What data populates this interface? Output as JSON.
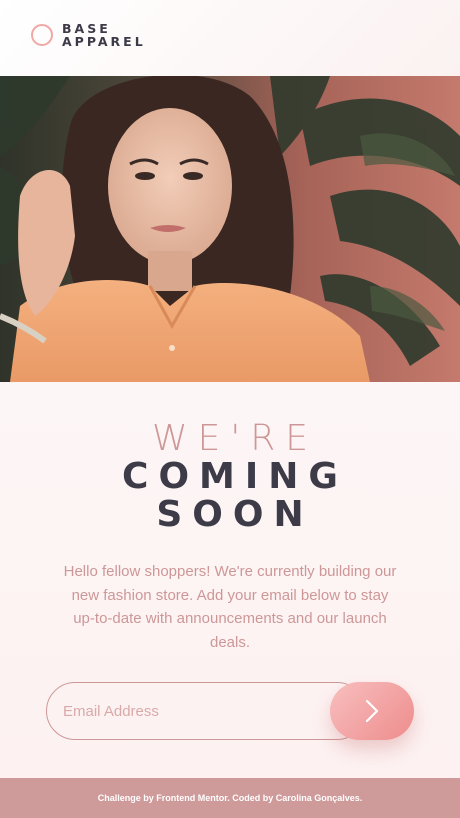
{
  "brand": {
    "line1": "BASE",
    "line2": "APPAREL",
    "accent_color": "#f1a8a4"
  },
  "hero": {
    "icon": "hero-photo-model"
  },
  "headline": {
    "light": "WE'RE",
    "bold_line1": "COMING",
    "bold_line2": "SOON"
  },
  "description": "Hello fellow shoppers! We're currently building our new fashion store. Add your email below to stay up-to-date with announcements and our launch deals.",
  "form": {
    "email_placeholder": "Email Address",
    "email_value": "",
    "submit_icon": "chevron-right-icon"
  },
  "footer": {
    "text": "Challenge by Frontend Mentor. Coded by Carolina Gonçalves."
  },
  "colors": {
    "primary": "#ce9797",
    "dark": "#3d3b48",
    "gradient_start": "#f8bfbf",
    "gradient_end": "#ee8c8c",
    "footer_bg": "#cf9a9a"
  }
}
